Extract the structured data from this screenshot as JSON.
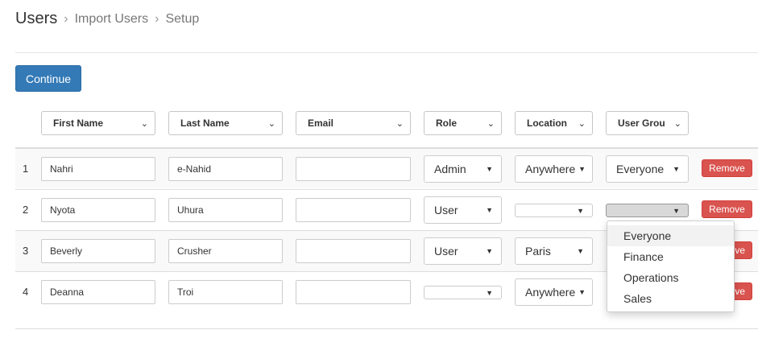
{
  "breadcrumb": {
    "root": "Users",
    "items": [
      "Import Users",
      "Setup"
    ],
    "separator": "›"
  },
  "actions": {
    "continue_label": "Continue"
  },
  "columns": [
    "First Name",
    "Last Name",
    "Email",
    "Role",
    "Location",
    "User Grou"
  ],
  "rows": [
    {
      "num": "1",
      "first": "Nahri",
      "last": "e-Nahid",
      "email": "",
      "role": "Admin",
      "location": "Anywhere",
      "group": "Everyone",
      "remove": "Remove"
    },
    {
      "num": "2",
      "first": "Nyota",
      "last": "Uhura",
      "email": "",
      "role": "User",
      "location": "",
      "group": "",
      "remove": "Remove"
    },
    {
      "num": "3",
      "first": "Beverly",
      "last": "Crusher",
      "email": "",
      "role": "User",
      "location": "Paris",
      "group": "",
      "remove": "ove"
    },
    {
      "num": "4",
      "first": "Deanna",
      "last": "Troi",
      "email": "",
      "role": "",
      "location": "Anywhere",
      "group": "",
      "remove": "ove"
    }
  ],
  "group_menu": {
    "options": [
      "Everyone",
      "Finance",
      "Operations",
      "Sales"
    ],
    "highlighted": "Everyone"
  },
  "colors": {
    "primary": "#337ab7",
    "danger": "#d9534f",
    "stripe": "#f9f9f9"
  }
}
